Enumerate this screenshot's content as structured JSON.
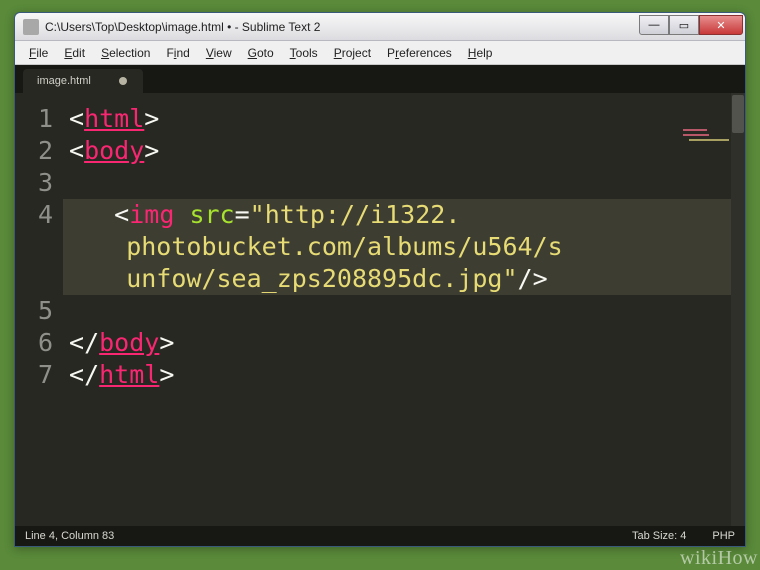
{
  "window": {
    "title": "C:\\Users\\Top\\Desktop\\image.html • - Sublime Text 2"
  },
  "menu": {
    "file": "File",
    "edit": "Edit",
    "selection": "Selection",
    "find": "Find",
    "view": "View",
    "goto": "Goto",
    "tools": "Tools",
    "project": "Project",
    "preferences": "Preferences",
    "help": "Help"
  },
  "tab": {
    "name": "image.html"
  },
  "gutter": {
    "l1": "1",
    "l2": "2",
    "l3": "3",
    "l4": "4",
    "l5": "5",
    "l6": "6",
    "l7": "7"
  },
  "code": {
    "lt": "<",
    "gt": ">",
    "sl": "/",
    "eq": "=",
    "q": "\"",
    "html": "html",
    "body": "body",
    "img": "img",
    "src": "src",
    "url1": "http://i1322.",
    "url2": "photobucket.com/albums/u564/s",
    "url3": "unfow/sea_zps208895dc.jpg",
    "indent": "   "
  },
  "status": {
    "left": "Line 4, Column 83",
    "tabsize": "Tab Size: 4",
    "syntax": "PHP"
  },
  "watermark": "wikiHow",
  "colors": {
    "bg": "#272822",
    "tag": "#f92672",
    "attr": "#a6e22e",
    "str": "#e6db74"
  }
}
